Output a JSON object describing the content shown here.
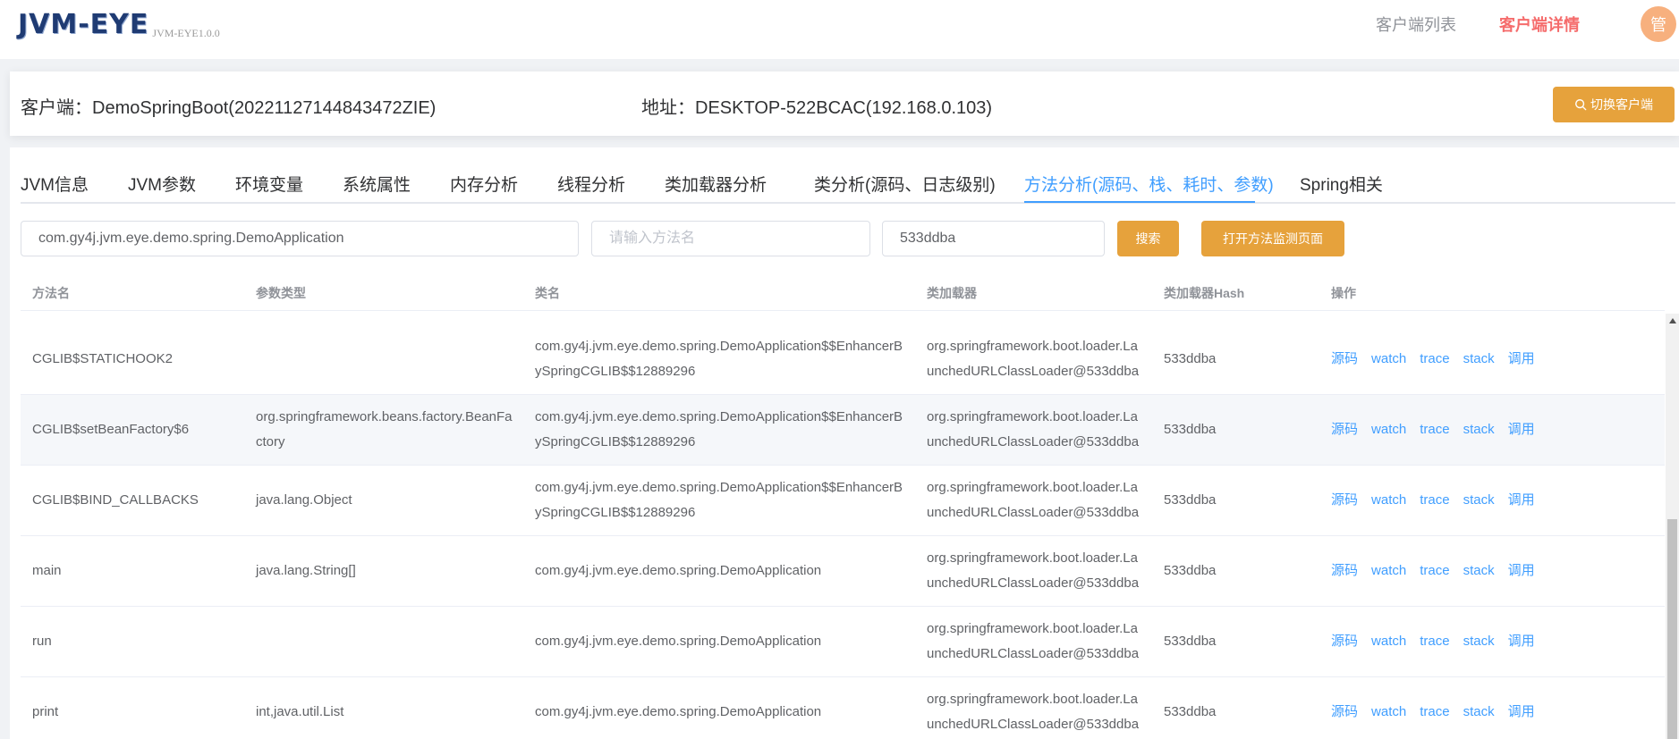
{
  "header": {
    "logo": "JVM-EYE",
    "version": "JVM-EYE1.0.0",
    "nav_list": "客户端列表",
    "nav_detail": "客户端详情",
    "avatar": "管"
  },
  "client": {
    "name": "客户端：DemoSpringBoot(20221127144843472ZIE)",
    "address": "地址：DESKTOP-522BCAC(192.168.0.103)",
    "switch_label": "切换客户端"
  },
  "tabs": [
    "JVM信息",
    "JVM参数",
    "环境变量",
    "系统属性",
    "内存分析",
    "线程分析",
    "类加载器分析",
    "类分析(源码、日志级别)",
    "方法分析(源码、栈、耗时、参数)",
    "Spring相关"
  ],
  "active_tab": 8,
  "search": {
    "class_value": "com.gy4j.jvm.eye.demo.spring.DemoApplication",
    "method_placeholder": "请输入方法名",
    "hash_value": "533ddba",
    "search_label": "搜索",
    "monitor_label": "打开方法监测页面"
  },
  "columns": [
    "方法名",
    "参数类型",
    "类名",
    "类加载器",
    "类加载器Hash",
    "操作"
  ],
  "actions": [
    "源码",
    "watch",
    "trace",
    "stack",
    "调用"
  ],
  "rows": [
    {
      "method": "CGLIB$STATICHOOK2",
      "params": [
        "",
        ""
      ],
      "class": [
        "com.gy4j.jvm.eye.demo.spring.DemoApplication$$EnhancerB",
        "ySpringCGLIB$$12889296"
      ],
      "loader": [
        "org.springframework.boot.loader.La",
        "unchedURLClassLoader@533ddba"
      ],
      "hash": "533ddba"
    },
    {
      "method": "CGLIB$setBeanFactory$6",
      "params": [
        "org.springframework.beans.factory.BeanFa",
        "ctory"
      ],
      "class": [
        "com.gy4j.jvm.eye.demo.spring.DemoApplication$$EnhancerB",
        "ySpringCGLIB$$12889296"
      ],
      "loader": [
        "org.springframework.boot.loader.La",
        "unchedURLClassLoader@533ddba"
      ],
      "hash": "533ddba"
    },
    {
      "method": "CGLIB$BIND_CALLBACKS",
      "params": [
        "java.lang.Object",
        ""
      ],
      "class": [
        "com.gy4j.jvm.eye.demo.spring.DemoApplication$$EnhancerB",
        "ySpringCGLIB$$12889296"
      ],
      "loader": [
        "org.springframework.boot.loader.La",
        "unchedURLClassLoader@533ddba"
      ],
      "hash": "533ddba"
    },
    {
      "method": "main",
      "params": [
        "java.lang.String[]",
        ""
      ],
      "class": [
        "com.gy4j.jvm.eye.demo.spring.DemoApplication",
        ""
      ],
      "loader": [
        "org.springframework.boot.loader.La",
        "unchedURLClassLoader@533ddba"
      ],
      "hash": "533ddba"
    },
    {
      "method": "run",
      "params": [
        "",
        ""
      ],
      "class": [
        "com.gy4j.jvm.eye.demo.spring.DemoApplication",
        ""
      ],
      "loader": [
        "org.springframework.boot.loader.La",
        "unchedURLClassLoader@533ddba"
      ],
      "hash": "533ddba"
    },
    {
      "method": "print",
      "params": [
        "int,java.util.List",
        ""
      ],
      "class": [
        "com.gy4j.jvm.eye.demo.spring.DemoApplication",
        ""
      ],
      "loader": [
        "org.springframework.boot.loader.La",
        "unchedURLClassLoader@533ddba"
      ],
      "hash": "533ddba"
    }
  ],
  "colors": {
    "accent": "#409eff",
    "warning": "#e6a23c",
    "danger": "#f56c6c"
  }
}
